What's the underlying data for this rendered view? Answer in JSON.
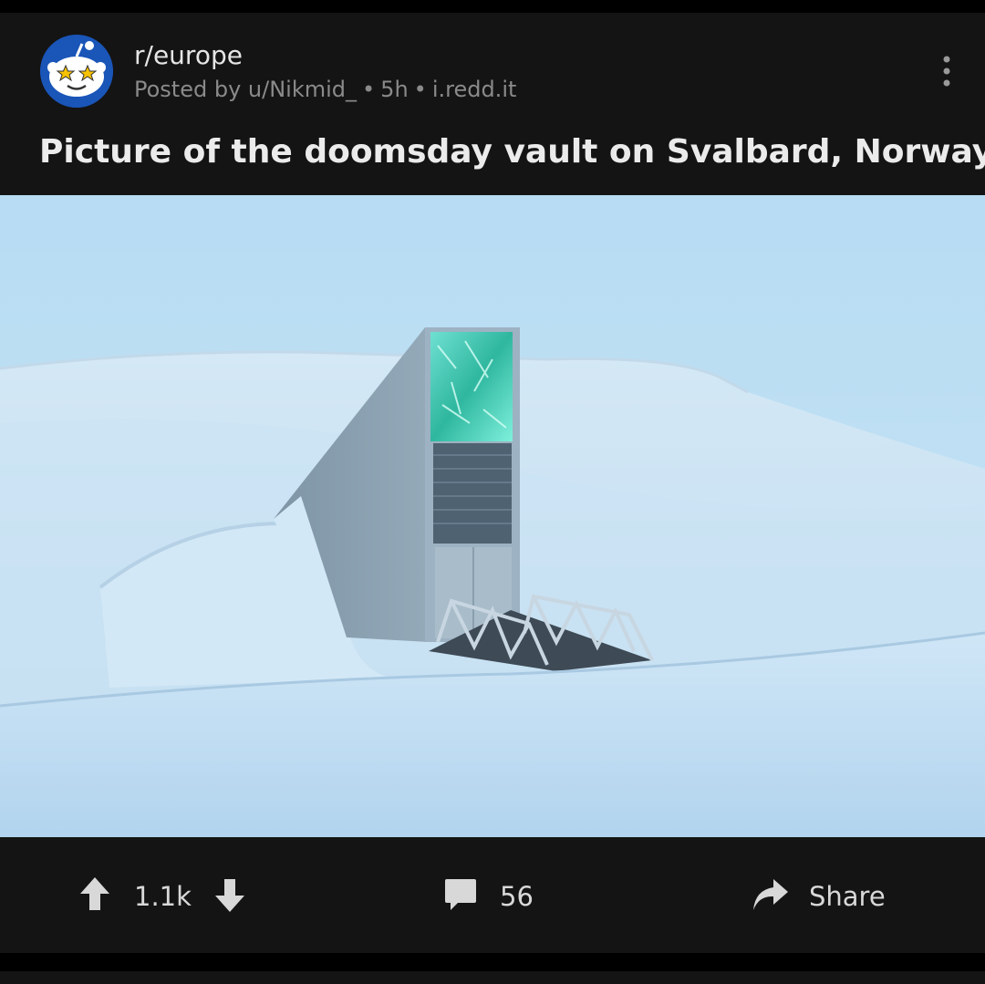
{
  "post": {
    "subreddit": "r/europe",
    "posted_by": "Posted by u/Nikmid_",
    "age": "5h",
    "domain": "i.redd.it",
    "title": "Picture of the doomsday vault on Svalbard, Norway"
  },
  "actions": {
    "score": "1.1k",
    "comments": "56",
    "share_label": "Share"
  },
  "icons": {
    "avatar": "subreddit-avatar-icon",
    "menu": "more-options-icon",
    "upvote": "upvote-arrow-icon",
    "downvote": "downvote-arrow-icon",
    "comment": "comment-bubble-icon",
    "share": "share-arrow-icon"
  },
  "colors": {
    "background": "#000000",
    "card": "#141414",
    "text_primary": "#e6e6e6",
    "text_meta": "#8a8a8a",
    "avatar_blue": "#1a55b8"
  }
}
